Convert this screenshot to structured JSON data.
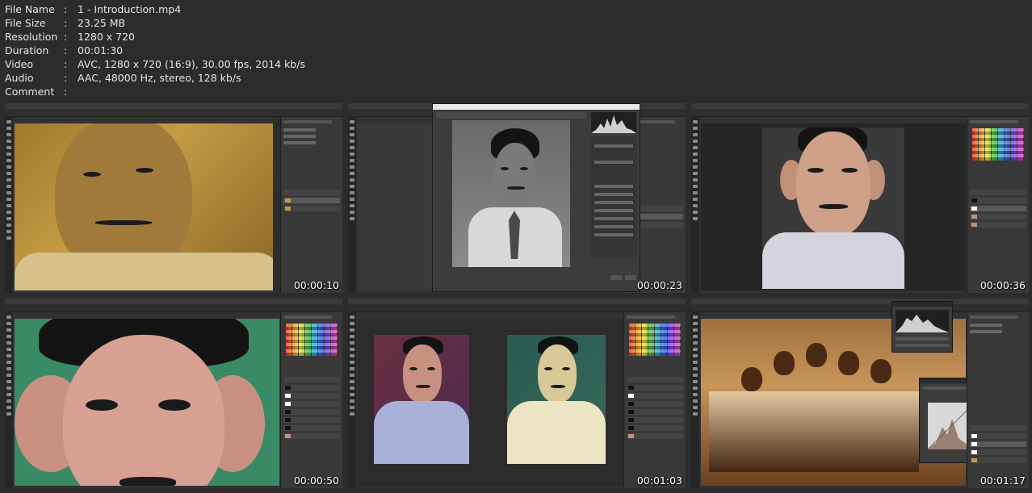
{
  "file_info": [
    {
      "key": "File Name",
      "value": "1 - Introduction.mp4"
    },
    {
      "key": "File Size",
      "value": "23.25 MB"
    },
    {
      "key": "Resolution",
      "value": "1280 x 720"
    },
    {
      "key": "Duration",
      "value": "00:01:30"
    },
    {
      "key": "Video",
      "value": "AVC, 1280 x 720 (16:9), 30.00 fps, 2014 kb/s"
    },
    {
      "key": "Audio",
      "value": "AAC, 48000 Hz, stereo, 128 kb/s"
    },
    {
      "key": "Comment",
      "value": ""
    }
  ],
  "colon": ":",
  "thumbnails": [
    {
      "timestamp": "00:00:10",
      "scene": "sepia portrait close-up"
    },
    {
      "timestamp": "00:00:23",
      "scene": "black and white portrait in camera raw dialog"
    },
    {
      "timestamp": "00:00:36",
      "scene": "colorized portrait on dark background"
    },
    {
      "timestamp": "00:00:50",
      "scene": "colorized portrait on green background"
    },
    {
      "timestamp": "00:01:03",
      "scene": "two portraits side by side"
    },
    {
      "timestamp": "00:01:17",
      "scene": "sepia group photo with histogram panels"
    }
  ]
}
